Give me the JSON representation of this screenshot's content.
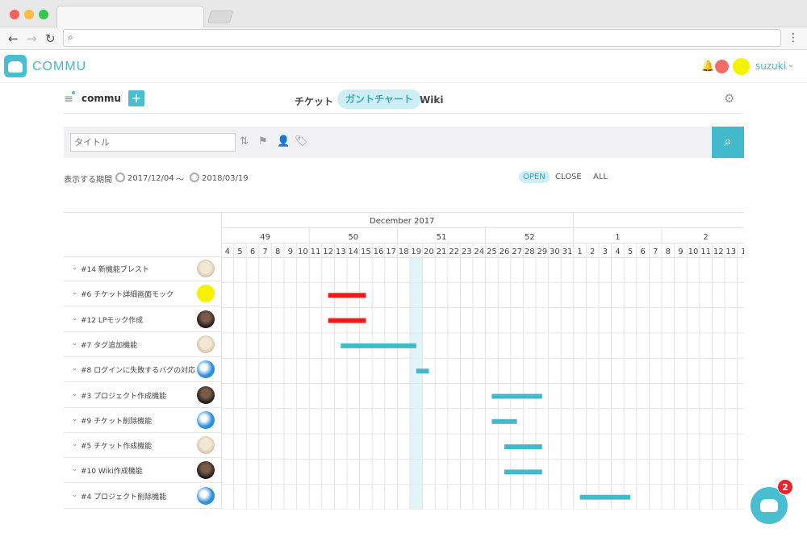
{
  "app": {
    "name": "COMMU",
    "username": "suzuki",
    "colors": {
      "accent": "#4bbdd0",
      "bar_red": "#f01a1a",
      "bar_teal": "#44b9cc",
      "today": "#e3f4f8"
    }
  },
  "project": {
    "name": "commu"
  },
  "nav": {
    "tickets": "チケット",
    "gantt": "ガントチャート",
    "wiki": "Wiki"
  },
  "search": {
    "placeholder": "タイトル"
  },
  "period": {
    "label": "表示する期間",
    "start": "2017/12/04",
    "tilde": "〜",
    "end": "2018/03/19"
  },
  "filters": {
    "open": "OPEN",
    "close": "CLOSE",
    "all": "ALL"
  },
  "gantt": {
    "month": "December 2017",
    "weeks": [
      {
        "label": "49",
        "start": "2017-12-04"
      },
      {
        "label": "50",
        "start": "2017-12-11"
      },
      {
        "label": "51",
        "start": "2017-12-18"
      },
      {
        "label": "52",
        "start": "2017-12-25"
      },
      {
        "label": "1",
        "start": "2018-01-01"
      },
      {
        "label": "2",
        "start": "2018-01-08"
      }
    ],
    "days": [
      "4",
      "5",
      "6",
      "7",
      "8",
      "9",
      "10",
      "11",
      "12",
      "13",
      "14",
      "15",
      "16",
      "17",
      "18",
      "19",
      "20",
      "21",
      "22",
      "23",
      "24",
      "25",
      "26",
      "27",
      "28",
      "29",
      "30",
      "31",
      "1",
      "2",
      "3",
      "4",
      "5",
      "6",
      "7",
      "8",
      "9",
      "10",
      "11",
      "12",
      "13",
      "1"
    ],
    "today": "2017-12-19",
    "tasks": [
      {
        "label": "#14 新機能ブレスト",
        "avatar": "dog",
        "bar": null
      },
      {
        "label": "#6 チケット詳細画面モック",
        "avatar": "yellow",
        "bar": {
          "start": "2017-12-12",
          "end": "2017-12-15",
          "color": "red"
        }
      },
      {
        "label": "#12 LPモック作成",
        "avatar": "dark",
        "bar": {
          "start": "2017-12-12",
          "end": "2017-12-15",
          "color": "red"
        }
      },
      {
        "label": "#7 タグ追加機能",
        "avatar": "dog",
        "bar": {
          "start": "2017-12-13",
          "end": "2017-12-19",
          "color": "teal"
        }
      },
      {
        "label": "#8 ログインに失敗するバグの対応",
        "avatar": "globe",
        "bar": {
          "start": "2017-12-19",
          "end": "2017-12-20",
          "color": "teal"
        }
      },
      {
        "label": "#3 プロジェクト作成機能",
        "avatar": "dark",
        "bar": {
          "start": "2017-12-25",
          "end": "2017-12-29",
          "color": "teal"
        }
      },
      {
        "label": "#9 チケット削除機能",
        "avatar": "globe",
        "bar": {
          "start": "2017-12-25",
          "end": "2017-12-27",
          "color": "teal"
        }
      },
      {
        "label": "#5 チケット作成機能",
        "avatar": "dog",
        "bar": {
          "start": "2017-12-26",
          "end": "2017-12-29",
          "color": "teal"
        }
      },
      {
        "label": "#10 Wiki作成機能",
        "avatar": "dark",
        "bar": {
          "start": "2017-12-26",
          "end": "2017-12-29",
          "color": "teal"
        }
      },
      {
        "label": "#4 プロジェクト削除機能",
        "avatar": "globe",
        "bar": {
          "start": "2018-01-01",
          "end": "2018-01-05",
          "color": "teal"
        }
      }
    ]
  },
  "chat": {
    "badge": "2"
  }
}
